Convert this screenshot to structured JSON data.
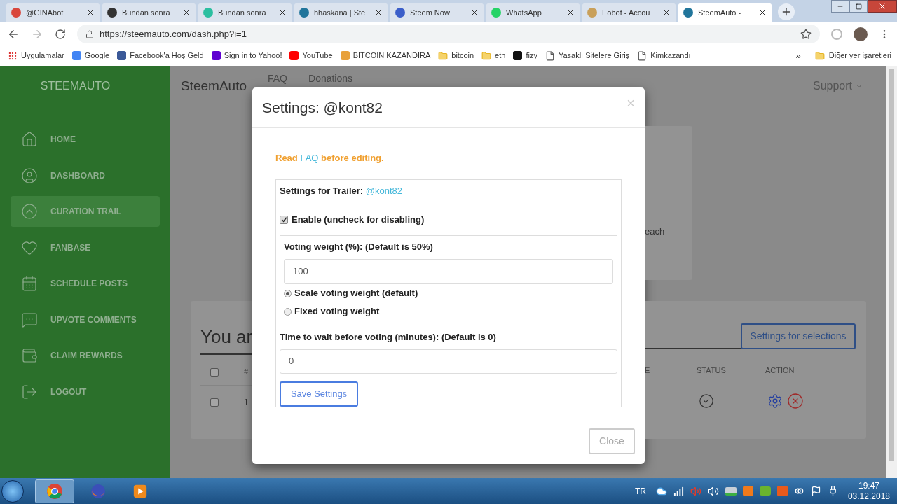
{
  "browser": {
    "tabs": [
      {
        "title": "@GINAbot",
        "selected": false,
        "color": "#d9473c"
      },
      {
        "title": "Bundan sonra",
        "selected": false,
        "color": "#333333"
      },
      {
        "title": "Bundan sonra",
        "selected": false,
        "color": "#2bbfa0"
      },
      {
        "title": "hhaskana | Ste",
        "selected": false,
        "color": "#21759b"
      },
      {
        "title": "Steem Now",
        "selected": false,
        "color": "#3b5ec9"
      },
      {
        "title": "WhatsApp",
        "selected": false,
        "color": "#25d366"
      },
      {
        "title": "Eobot - Accou",
        "selected": false,
        "color": "#c9a05a"
      },
      {
        "title": "SteemAuto -",
        "selected": true,
        "color": "#21759b"
      }
    ],
    "url": "https://steemauto.com/dash.php?i=1",
    "bookmarks": [
      {
        "label": "Uygulamalar",
        "kind": "apps"
      },
      {
        "label": "Google",
        "kind": "site",
        "color": "#4285f4"
      },
      {
        "label": "Facebook'a Hoş Geld",
        "kind": "site",
        "color": "#3b5998"
      },
      {
        "label": "Sign in to Yahoo!",
        "kind": "site",
        "color": "#5f01d1"
      },
      {
        "label": "YouTube",
        "kind": "site",
        "color": "#ff0000"
      },
      {
        "label": "BITCOIN KAZANDIRA",
        "kind": "site",
        "color": "#e8a13a"
      },
      {
        "label": "bitcoin",
        "kind": "folder"
      },
      {
        "label": "eth",
        "kind": "folder"
      },
      {
        "label": "fizy",
        "kind": "site",
        "color": "#111111"
      },
      {
        "label": "Yasaklı Sitelere Giriş",
        "kind": "page"
      },
      {
        "label": "Kimkazandı",
        "kind": "page"
      }
    ],
    "more": "»",
    "other_bookmarks": "Diğer yer işaretleri"
  },
  "sidebar": {
    "brand": "STEEMAUTO",
    "items": [
      {
        "label": "HOME",
        "selected": false
      },
      {
        "label": "DASHBOARD",
        "selected": false
      },
      {
        "label": "CURATION TRAIL",
        "selected": true
      },
      {
        "label": "FANBASE",
        "selected": false
      },
      {
        "label": "SCHEDULE POSTS",
        "selected": false
      },
      {
        "label": "UPVOTE COMMENTS",
        "selected": false
      },
      {
        "label": "CLAIM REWARDS",
        "selected": false
      },
      {
        "label": "LOGOUT",
        "selected": false
      }
    ]
  },
  "navbar": {
    "brand": "SteemAuto",
    "links": [
      "FAQ",
      "Donations"
    ],
    "support": "Support"
  },
  "background": {
    "card_text": "each",
    "heading": "You ar",
    "selections_button": "Settings for selections",
    "columns": [
      "#",
      "E",
      "STATUS",
      "ACTION"
    ],
    "row_number": "1",
    "select_all_checked": false,
    "row_checked": false
  },
  "modal": {
    "title": "Settings: @kont82",
    "close_icon": "×",
    "notice": {
      "before": "Read",
      "link": "FAQ",
      "after": "before editing."
    },
    "trailer_label": "Settings for Trailer:",
    "trailer": "@kont82",
    "enable": {
      "label": "Enable (uncheck for disabling)",
      "checked": true
    },
    "weight_label": "Voting weight (%): (Default is 50%)",
    "weight_value": "100",
    "modes": [
      {
        "label": "Scale voting weight (default)",
        "selected": true
      },
      {
        "label": "Fixed voting weight",
        "selected": false
      }
    ],
    "wait_label": "Time to wait before voting (minutes): (Default is 0)",
    "wait_value": "0",
    "save": "Save Settings",
    "close": "Close"
  },
  "taskbar": {
    "language": "TR",
    "time": "19:47",
    "date": "03.12.2018"
  }
}
